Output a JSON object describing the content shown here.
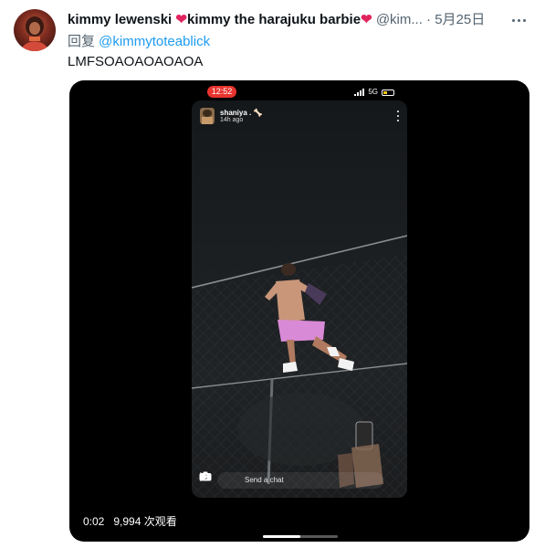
{
  "tweet": {
    "display_name": "kimmy lewenski ",
    "display_name_2": "kimmy the harajuku barbie",
    "heart": "❤",
    "handle": "@kim...",
    "dot": "·",
    "time": "5月25日",
    "reply_prefix": "回复 ",
    "reply_to": "@kimmytoteablick",
    "text": "LMFSOAOAOAOAOA"
  },
  "video": {
    "elapsed": "0:02",
    "views": "9,994 次观看",
    "progress_fraction": 0.5,
    "snap": {
      "status_time": "12:52",
      "network": "5G",
      "username": "shaniya . 🦴",
      "age": "14h ago",
      "chat_placeholder": "Send a chat"
    }
  },
  "colors": {
    "accent": "#1d9bf0",
    "heart": "#e0245e",
    "muted": "#536471",
    "snap_time_pill": "#e8332f"
  }
}
